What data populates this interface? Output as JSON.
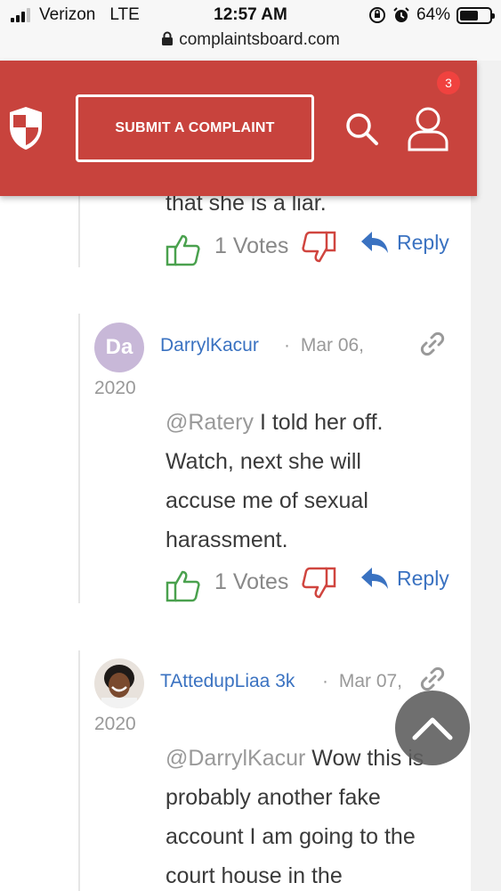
{
  "status_bar": {
    "carrier": "Verizon",
    "network": "LTE",
    "time": "12:57 AM",
    "battery": "64%",
    "battery_level": 0.64,
    "url": "complaintsboard.com"
  },
  "header": {
    "submit_label": "SUBMIT A COMPLAINT",
    "notification_count": "3",
    "accent_color": "#c8433d"
  },
  "comments": [
    {
      "text_lines": [
        "that she is a liar."
      ],
      "votes": "1 Votes",
      "reply_label": "Reply"
    },
    {
      "avatar_initials": "Da",
      "author": "DarrylKacur",
      "date_part1": "Mar 06,",
      "date_part2": "2020",
      "mention": "@Ratery",
      "line1_rest": " I told her off.",
      "line2": "Watch, next she will",
      "line3": "accuse me of sexual",
      "line4": "harassment.",
      "votes": "1 Votes",
      "reply_label": "Reply"
    },
    {
      "author": "TAttedupLiaa 3k",
      "date_part1": "Mar 07,",
      "date_part2": "2020",
      "mention": "@DarrylKacur",
      "line1_rest": " Wow this is",
      "line2": "probably another fake",
      "line3": "account I am going to the",
      "line4": "court house in the"
    }
  ],
  "icons": {
    "logo": "shield-logo",
    "search": "search-icon",
    "user": "user-icon",
    "upvote": "thumbs-up-icon",
    "downvote": "thumbs-down-icon",
    "reply": "reply-arrow-icon",
    "permalink": "link-icon",
    "scroll_top": "chevron-up-icon"
  }
}
